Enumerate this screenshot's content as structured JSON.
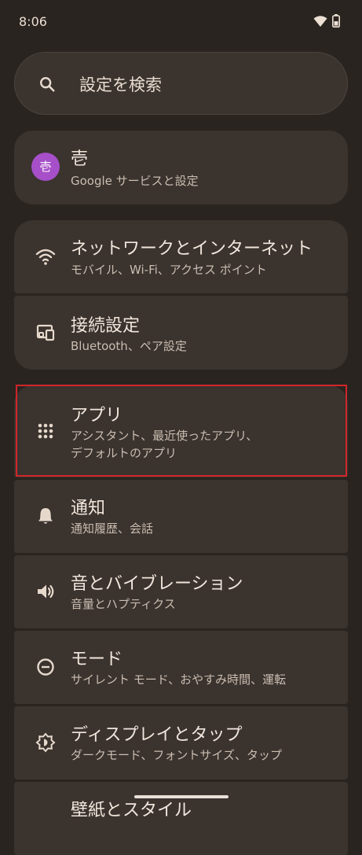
{
  "status_bar": {
    "time": "8:06",
    "wifi_icon": "wifi-icon",
    "battery_icon": "battery-icon"
  },
  "search": {
    "placeholder": "設定を検索",
    "icon": "search-icon"
  },
  "account": {
    "avatar_letter": "壱",
    "name": "壱",
    "subtitle": "Google サービスと設定",
    "avatar_color": "#a64fc8"
  },
  "settings": [
    {
      "icon": "wifi-icon",
      "title": "ネットワークとインターネット",
      "subtitle": "モバイル、Wi-Fi、アクセス ポイント"
    },
    {
      "icon": "devices-icon",
      "title": "接続設定",
      "subtitle": "Bluetooth、ペア設定"
    },
    {
      "icon": "apps-grid-icon",
      "title": "アプリ",
      "subtitle_line1": "アシスタント、最近使ったアプリ、",
      "subtitle_line2": "デフォルトのアプリ"
    },
    {
      "icon": "bell-icon",
      "title": "通知",
      "subtitle": "通知履歴、会話"
    },
    {
      "icon": "volume-icon",
      "title": "音とバイブレーション",
      "subtitle": "音量とハプティクス"
    },
    {
      "icon": "minus-circle-icon",
      "title": "モード",
      "subtitle": "サイレント モード、おやすみ時間、運転"
    },
    {
      "icon": "brightness-icon",
      "title": "ディスプレイとタップ",
      "subtitle": "ダークモード、フォントサイズ、タップ"
    },
    {
      "icon": "palette-icon",
      "title": "壁紙とスタイル"
    }
  ],
  "colors": {
    "background": "#2a2420",
    "card": "#3a332e",
    "highlight": "#d0262a"
  }
}
